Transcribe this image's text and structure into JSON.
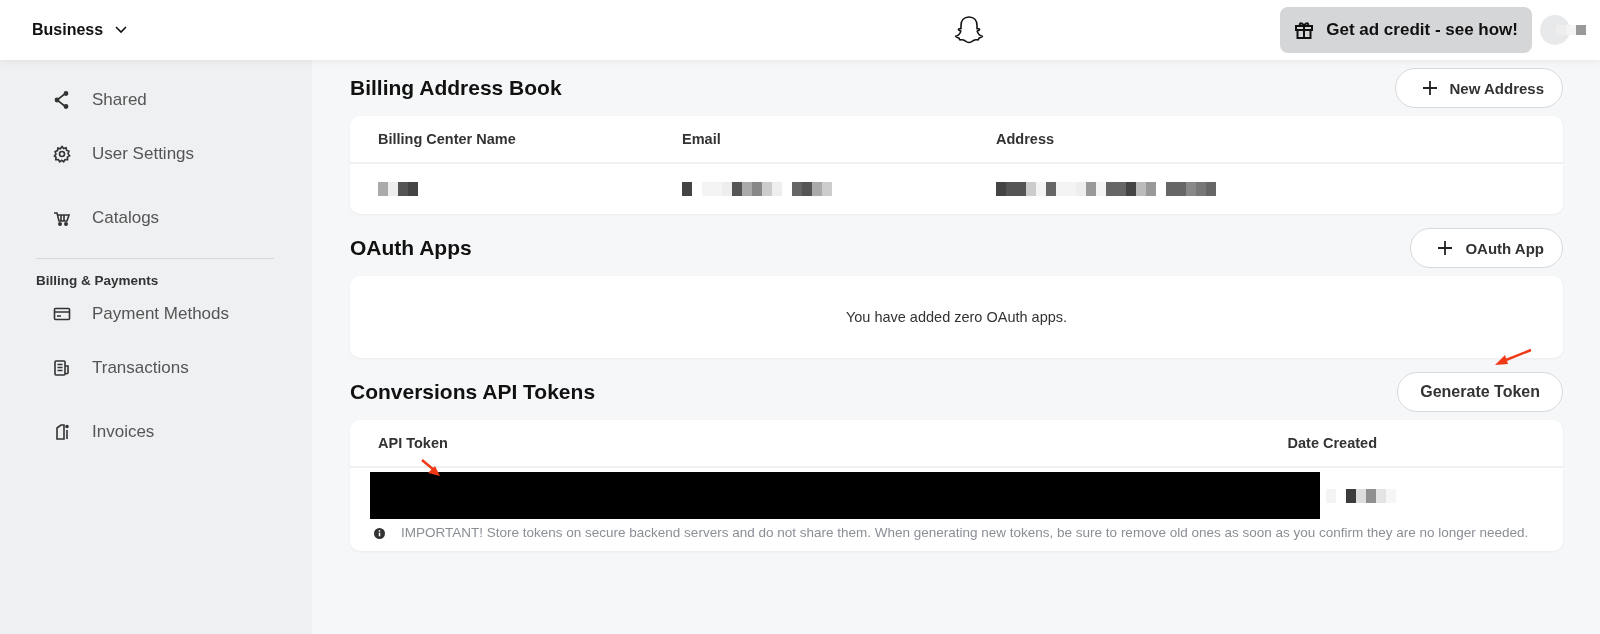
{
  "header": {
    "workspace": "Business",
    "promo_button": "Get ad credit - see how!"
  },
  "sidebar": {
    "items": [
      {
        "label": "Shared",
        "kind": "share"
      },
      {
        "label": "User Settings",
        "kind": "gear"
      },
      {
        "label": "Catalogs",
        "kind": "cart"
      }
    ],
    "section": "Billing & Payments",
    "section_items": [
      {
        "label": "Payment Methods",
        "kind": "card"
      },
      {
        "label": "Transactions",
        "kind": "receipt"
      },
      {
        "label": "Invoices",
        "kind": "invoice"
      }
    ]
  },
  "billing_address_book": {
    "title": "Billing Address Book",
    "button": "New Address",
    "columns": [
      "Billing Center Name",
      "Email",
      "Address"
    ]
  },
  "oauth_apps": {
    "title": "OAuth Apps",
    "button": "OAuth App",
    "empty_message": "You have added zero OAuth apps."
  },
  "conversions_api_tokens": {
    "title": "Conversions API Tokens",
    "button": "Generate Token",
    "columns": [
      "API Token",
      "Date Created"
    ],
    "note": "IMPORTANT! Store tokens on secure backend servers and do not share them. When generating new tokens, be sure to remove old ones as soon as you confirm they are no longer needed."
  }
}
